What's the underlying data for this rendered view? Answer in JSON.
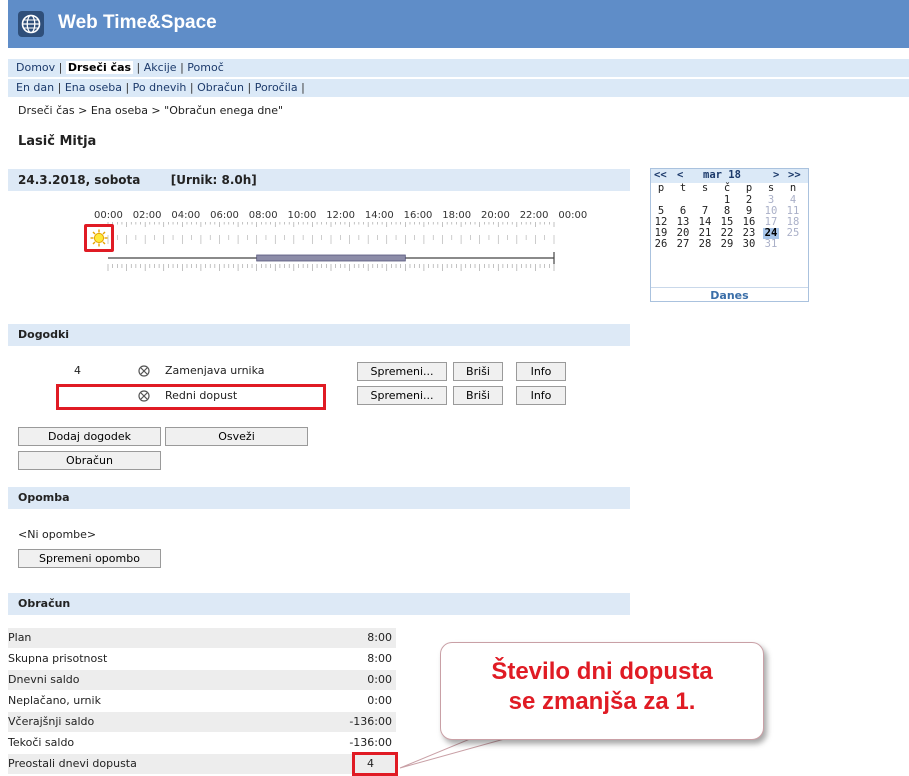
{
  "app": {
    "title": "Web Time&Space",
    "icon": "globe-icon"
  },
  "nav_main": {
    "items": [
      {
        "label": "Domov",
        "active": false
      },
      {
        "label": "Drseči čas",
        "active": true
      },
      {
        "label": "Akcije",
        "active": false
      },
      {
        "label": "Pomoč",
        "active": false
      }
    ]
  },
  "nav_sub": {
    "items": [
      "En dan",
      "Ena oseba",
      "Po dnevih",
      "Obračun",
      "Poročila"
    ]
  },
  "breadcrumb": "Drseči čas > Ena oseba > \"Obračun enega dne\"",
  "person": "Lasič Mitja",
  "day": {
    "date": "24.3.2018, sobota",
    "schedule": "[Urnik: 8.0h]"
  },
  "timeline": {
    "hours": [
      "00:00",
      "02:00",
      "04:00",
      "06:00",
      "08:00",
      "10:00",
      "12:00",
      "14:00",
      "16:00",
      "18:00",
      "20:00",
      "22:00",
      "00:00"
    ],
    "icon": "sun-icon",
    "planned_from_hour": 8,
    "planned_to_hour": 16
  },
  "calendar": {
    "nav": {
      "prev_year": "<<",
      "prev": "<",
      "month": "mar 18",
      "next": ">",
      "next_year": ">>"
    },
    "weekdays": [
      "p",
      "t",
      "s",
      "č",
      "p",
      "s",
      "n"
    ],
    "weeks": [
      [
        "",
        "",
        "",
        "1",
        "2",
        "3",
        "4"
      ],
      [
        "5",
        "6",
        "7",
        "8",
        "9",
        "10",
        "11"
      ],
      [
        "12",
        "13",
        "14",
        "15",
        "16",
        "17",
        "18"
      ],
      [
        "19",
        "20",
        "21",
        "22",
        "23",
        "24",
        "25"
      ],
      [
        "26",
        "27",
        "28",
        "29",
        "30",
        "31",
        ""
      ]
    ],
    "today": "24",
    "today_link": "Danes"
  },
  "dogodki": {
    "title": "Dogodki",
    "events": [
      {
        "num": "4",
        "icon": "cancel-circle-icon",
        "label": "Zamenjava urnika"
      },
      {
        "num": "",
        "icon": "cancel-circle-icon",
        "label": "Redni dopust"
      }
    ],
    "btn_edit": "Spremeni...",
    "btn_delete": "Briši",
    "btn_info": "Info",
    "btn_add": "Dodaj dogodek",
    "btn_refresh": "Osveži",
    "btn_calc": "Obračun"
  },
  "opomba": {
    "title": "Opomba",
    "text": "<Ni opombe>",
    "btn_edit": "Spremeni opombo"
  },
  "obracun": {
    "title": "Obračun",
    "rows": [
      {
        "label": "Plan",
        "value": "8:00"
      },
      {
        "label": "Skupna prisotnost",
        "value": "8:00"
      },
      {
        "label": "Dnevni saldo",
        "value": "0:00"
      },
      {
        "label": "Neplačano, urnik",
        "value": "0:00"
      },
      {
        "label": "Včerajšnji saldo",
        "value": "-136:00"
      },
      {
        "label": "Tekoči saldo",
        "value": "-136:00"
      },
      {
        "label": "Preostali dnevi dopusta",
        "value": "4"
      }
    ]
  },
  "callout": {
    "text": "Število dni dopusta\nse zmanjša za 1."
  },
  "colors": {
    "header": "#5f8dc8",
    "section": "#dde9f6",
    "highlight": "#e01b24",
    "today": "#a9c6ea"
  }
}
